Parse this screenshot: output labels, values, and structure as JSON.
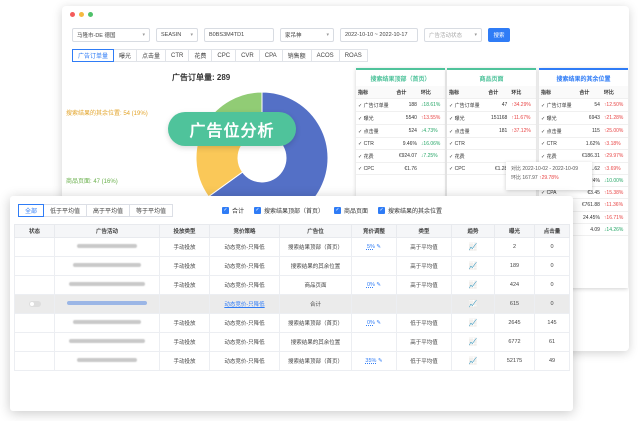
{
  "colors": {
    "accent": "#2f7cf6",
    "green": "#4fc39b",
    "red": "#e84545",
    "down": "#27a768",
    "donut_blue": "#5470c6",
    "donut_yellow": "#fac858",
    "donut_green": "#91cc75"
  },
  "filters": {
    "marketplace": "马隆市-DE 德国",
    "asin": "SEASIN",
    "asin_value": "B0BS3M4TD1",
    "campaign": "家吊神",
    "date_range": "2022-10-10 ~ 2022-10-17",
    "placeholder": "广告活动状态",
    "search": "搜索"
  },
  "metric_tabs": [
    "广告订单量",
    "曝光",
    "点击量",
    "CTR",
    "花费",
    "CPC",
    "CVR",
    "CPA",
    "销售额",
    "ACOS",
    "ROAS"
  ],
  "chart": {
    "title_label": "广告订单量:",
    "title_value": "289",
    "legend_top": "搜索结果的其余位置:",
    "legend_top_value": "54 (19%)",
    "legend_mid": "商品页面:",
    "legend_mid_value": "47 (16%)"
  },
  "chart_data": {
    "type": "pie",
    "categories": [
      "搜索结果顶部（首页）",
      "搜索结果的其余位置",
      "商品页面"
    ],
    "values": [
      188,
      54,
      47
    ],
    "title": "广告订单量: 289"
  },
  "badge": "广告位分析",
  "cards": [
    {
      "title": "搜索结果顶部（首页）",
      "head": [
        "指标",
        "合计",
        "环比"
      ],
      "rows": [
        [
          "广告订单量",
          "188",
          "18.61%",
          "down"
        ],
        [
          "曝光",
          "5540",
          "13.55%",
          "up"
        ],
        [
          "点击量",
          "524",
          "4.73%",
          "down"
        ],
        [
          "CTR",
          "9.46%",
          "16.06%",
          "down"
        ],
        [
          "花费",
          "€924.07",
          "7.25%",
          "down"
        ],
        [
          "CPC",
          "€1.76",
          "",
          "up"
        ]
      ]
    },
    {
      "title": "商品页面",
      "head": [
        "指标",
        "合计",
        "环比"
      ],
      "rows": [
        [
          "广告订单量",
          "47",
          "34.29%",
          "up"
        ],
        [
          "曝光",
          "151168",
          "11.67%",
          "up"
        ],
        [
          "点击量",
          "181",
          "37.12%",
          "up"
        ],
        [
          "CTR",
          "",
          "",
          ""
        ],
        [
          "花费",
          "",
          "",
          ""
        ],
        [
          "CPC",
          "€1.28",
          "5.51%",
          "down"
        ]
      ]
    },
    {
      "title": "搜索结果的其余位置",
      "head": [
        "指标",
        "合计",
        "环比"
      ],
      "rows": [
        [
          "广告订单量",
          "54",
          "12.50%",
          "up"
        ],
        [
          "曝光",
          "6943",
          "21.28%",
          "up"
        ],
        [
          "点击量",
          "115",
          "25.00%",
          "up"
        ],
        [
          "CTR",
          "1.62%",
          "3.18%",
          "up"
        ],
        [
          "花费",
          "€186.31",
          "29.97%",
          "up"
        ],
        [
          "CPC",
          "€1.62",
          "3.69%",
          "up"
        ],
        [
          "CVR",
          "37.24%",
          "10.00%",
          "down"
        ],
        [
          "CPA",
          "€3.45",
          "15.38%",
          "up"
        ],
        [
          "销售额",
          "€761.88",
          "11.36%",
          "up"
        ],
        [
          "ACOS",
          "24.45%",
          "16.71%",
          "up"
        ],
        [
          "ROAS",
          "4.09",
          "14.26%",
          "down"
        ]
      ]
    }
  ],
  "tooltip": {
    "line1": "对比 2022-10-02 - 2022-10-09",
    "line2": "环比 167.97",
    "line3": "29.78%"
  },
  "panel": {
    "tabs": [
      "全部",
      "低于平均值",
      "高于平均值",
      "等于平均值"
    ],
    "checks": [
      "合计",
      "搜索结果顶部（首页）",
      "商品页面",
      "搜索结果的其余位置"
    ],
    "headers": [
      "状态",
      "广告活动",
      "投放类型",
      "竞价策略",
      "广告位",
      "竞价调整",
      "类型",
      "趋势",
      "曝光",
      "点击量"
    ],
    "rows": [
      {
        "type": "手动投放",
        "strategy": "动态竞价-只降低",
        "place": "搜索结果顶部（首页）",
        "adj": "5%",
        "kind": "高于平均值",
        "exp": "2",
        "clk": "0"
      },
      {
        "type": "手动投放",
        "strategy": "动态竞价-只降低",
        "place": "搜索结果的其余位置",
        "adj": "",
        "kind": "高于平均值",
        "exp": "189",
        "clk": "0"
      },
      {
        "type": "手动投放",
        "strategy": "动态竞价-只降低",
        "place": "商品页面",
        "adj": "0%",
        "kind": "高于平均值",
        "exp": "424",
        "clk": "0"
      },
      {
        "type": "",
        "strategy": "动态竞价-只降低",
        "place": "合计",
        "adj": "",
        "kind": "",
        "exp": "615",
        "clk": "0"
      },
      {
        "type": "手动投放",
        "strategy": "动态竞价-只降低",
        "place": "搜索结果顶部（首页）",
        "adj": "0%",
        "kind": "低于平均值",
        "exp": "2645",
        "clk": "145"
      },
      {
        "type": "手动投放",
        "strategy": "动态竞价-只降低",
        "place": "搜索结果的其余位置",
        "adj": "",
        "kind": "高于平均值",
        "exp": "6772",
        "clk": "61"
      },
      {
        "type": "手动投放",
        "strategy": "动态竞价-只降低",
        "place": "搜索结果顶部（首页）",
        "adj": "35%",
        "kind": "低于平均值",
        "exp": "52175",
        "clk": "49"
      }
    ]
  }
}
